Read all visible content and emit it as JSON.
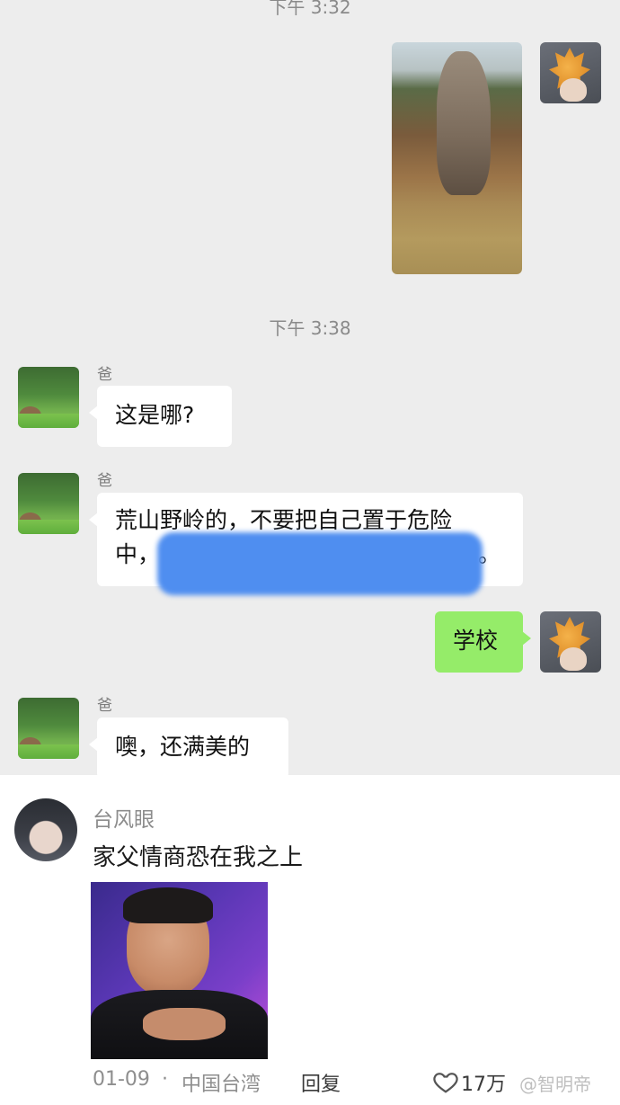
{
  "chat": {
    "time1": "下午 3:32",
    "time2": "下午 3:38",
    "messages": [
      {
        "sender": "爸",
        "text": "这是哪?"
      },
      {
        "sender": "爸",
        "line1": "荒山野岭的，不要把自己置于危险",
        "line2_start": "中，",
        "line2_end": "。"
      },
      {
        "me": true,
        "text": "学校"
      },
      {
        "sender": "爸",
        "text": "噢，还满美的"
      }
    ]
  },
  "comment": {
    "username": "台风眼",
    "text": "家父情商恐在我之上",
    "date": "01-09",
    "location": "中国台湾",
    "reply_label": "回复",
    "like_count": "17万"
  },
  "watermark": "@智明帝"
}
